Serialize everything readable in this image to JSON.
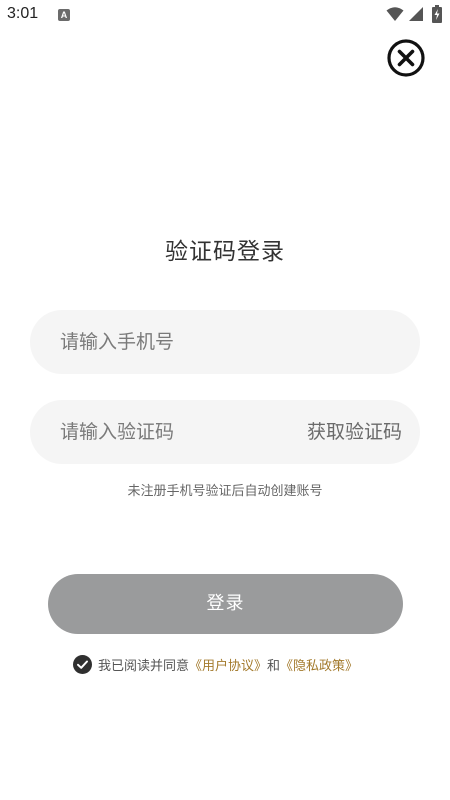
{
  "status_bar": {
    "time": "3:01",
    "notification_letter": "A"
  },
  "title": "验证码登录",
  "phone_field": {
    "value": "",
    "placeholder": "请输入手机号"
  },
  "code_field": {
    "value": "",
    "placeholder": "请输入验证码",
    "get_code_label": "获取验证码"
  },
  "hint": "未注册手机号验证后自动创建账号",
  "login_label": "登录",
  "agreement": {
    "prefix": "我已阅读并同意",
    "user_agreement": "《用户协议》",
    "conjunction": "和",
    "privacy_policy": "《隐私政策》",
    "checked": true
  },
  "colors": {
    "link": "#a37a2c",
    "login_button": "#9a9b9c",
    "field_background": "#f5f5f5",
    "check": "#2f2f2f"
  },
  "icons": {
    "close": "close-circle-icon",
    "check": "check-circle-icon",
    "wifi": "wifi-icon",
    "signal": "signal-icon",
    "battery": "battery-charging-icon"
  }
}
